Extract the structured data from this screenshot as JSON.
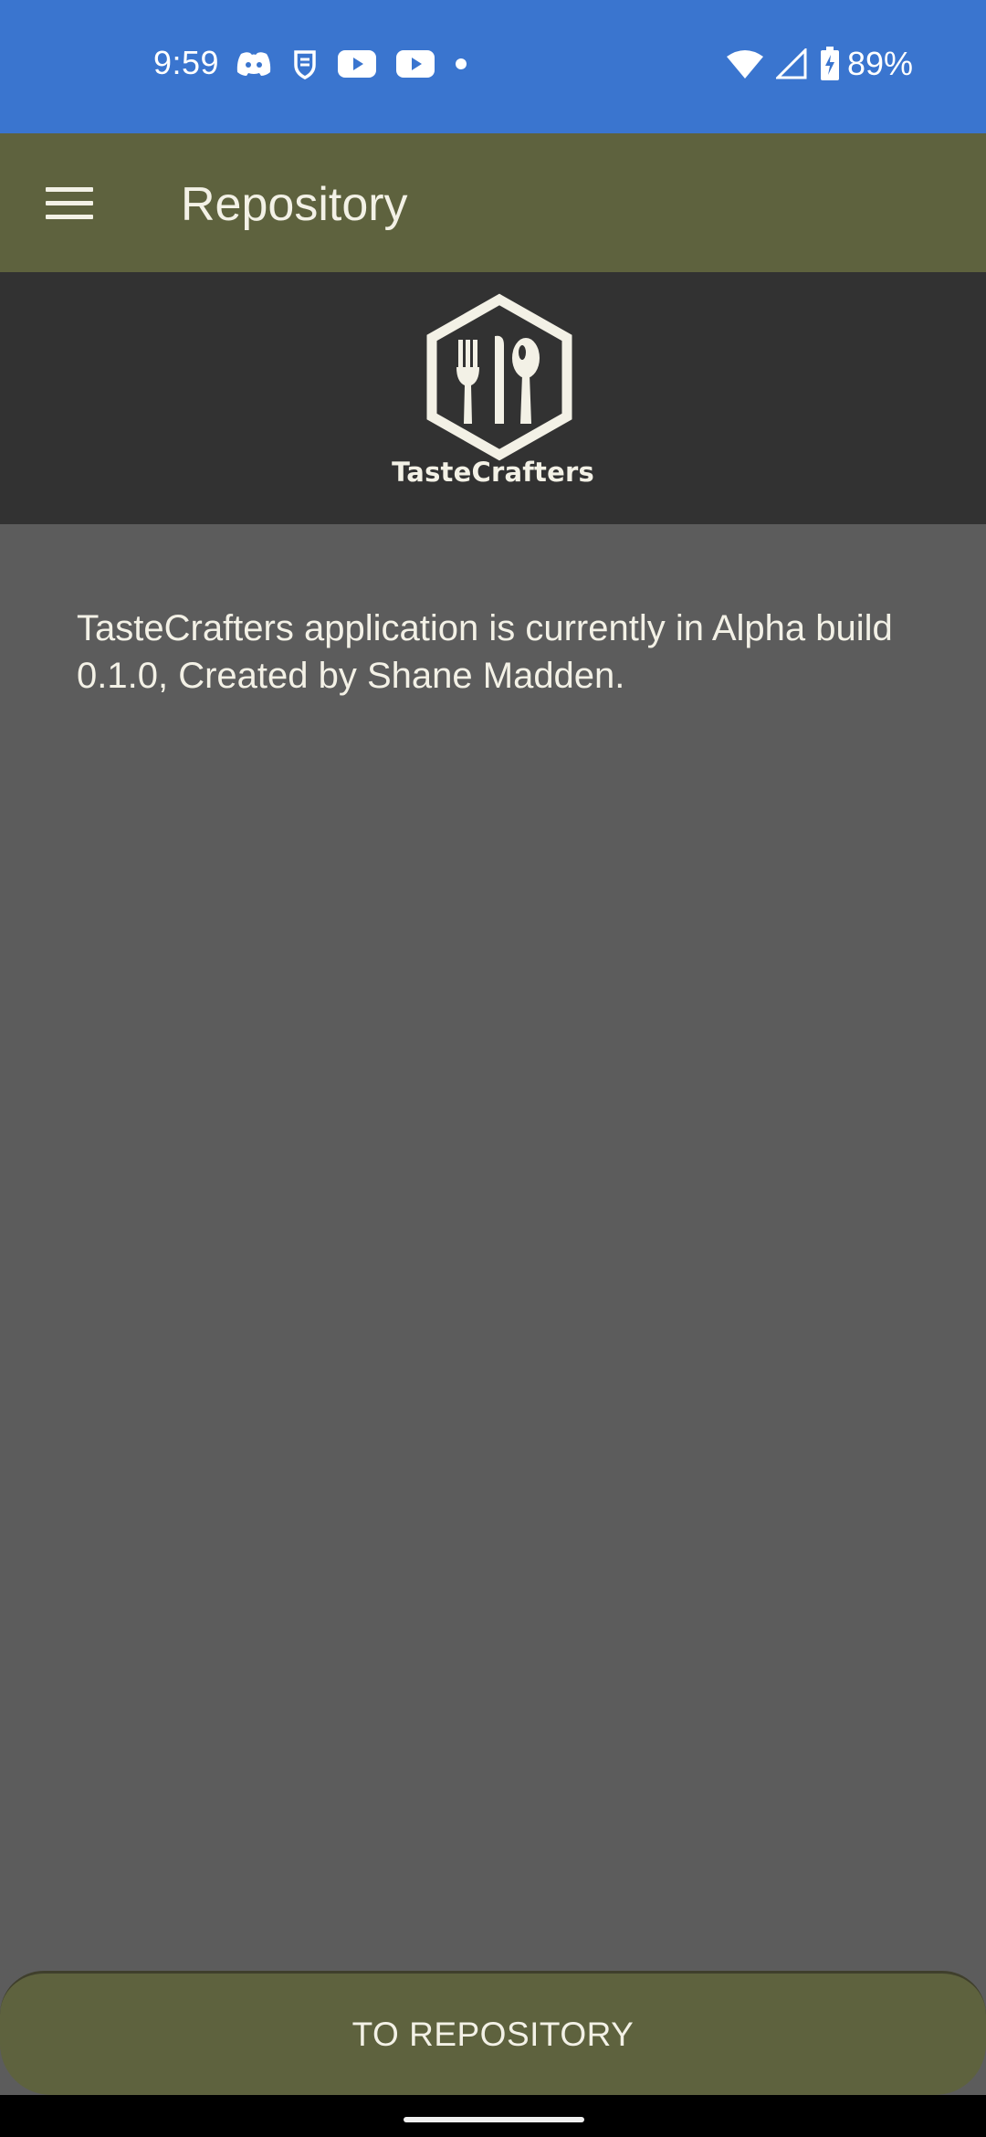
{
  "status_bar": {
    "time": "9:59",
    "battery_percent": "89%",
    "left_icons": [
      "discord-icon",
      "bitwarden-icon",
      "youtube-icon",
      "youtube-icon",
      "dot-icon"
    ],
    "right_icons": [
      "wifi-icon",
      "cell-signal-icon",
      "battery-charging-icon"
    ],
    "background_color": "#3a75cf"
  },
  "app_bar": {
    "title": "Repository",
    "menu_icon": "hamburger-menu-icon",
    "background_color": "#5e623e"
  },
  "logo_banner": {
    "brand_name": "TasteCrafters",
    "logo_icon": "hexagon-fork-knife-spoon-icon",
    "background_color": "#323232"
  },
  "content": {
    "description": "TasteCrafters application is currently in Alpha build 0.1.0, Created by Shane Madden."
  },
  "bottom_button": {
    "label": "TO REPOSITORY",
    "background_color": "#5e623e"
  },
  "colors": {
    "page_background": "#5c5c5c",
    "text_light": "#f3f1e6"
  }
}
